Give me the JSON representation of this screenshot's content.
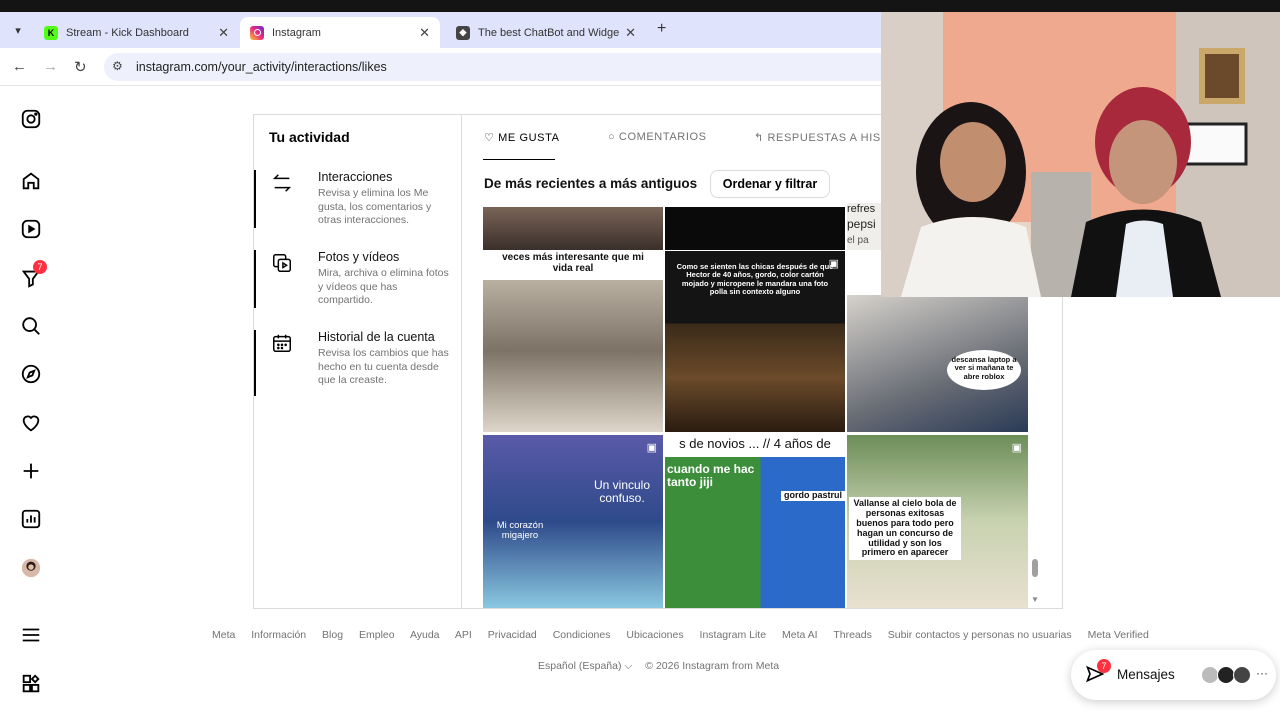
{
  "browser": {
    "tabs": [
      {
        "title": "Stream - Kick Dashboard",
        "favicon": "kick-logo",
        "active": false
      },
      {
        "title": "Instagram",
        "favicon": "instagram-logo",
        "active": true
      },
      {
        "title": "The best ChatBot and Widgets f",
        "favicon": "botrix-logo",
        "active": false
      }
    ],
    "url": "instagram.com/your_activity/interactions/likes"
  },
  "rail": {
    "notifications_badge": "7"
  },
  "activity": {
    "title": "Tu actividad",
    "items": [
      {
        "heading": "Interacciones",
        "desc": "Revisa y elimina los Me gusta, los comentarios y otras interacciones."
      },
      {
        "heading": "Fotos y vídeos",
        "desc": "Mira, archiva o elimina fotos y vídeos que has compartido."
      },
      {
        "heading": "Historial de la cuenta",
        "desc": "Revisa los cambios que has hecho en tu cuenta desde que la creaste."
      }
    ],
    "tabs": [
      {
        "label": "ME GUSTA"
      },
      {
        "label": "COMENTARIOS"
      },
      {
        "label": "RESPUESTAS A HISTO"
      }
    ],
    "sort_label": "De más recientes a más antiguos",
    "sort_button": "Ordenar y filtrar",
    "memes": {
      "c1": "veces más interesante que mi vida real",
      "c2": "Como se sienten las chicas después de que Hector de 40 años, gordo, color cartón mojado y micropene le mandara una foto polla sin contexto alguno",
      "c3a": "refres",
      "c3b": "pepsi",
      "c3c": "el pa",
      "c4": "descansa laptop a ver si mañana te abre roblox",
      "c5a": "Un vinculo confuso.",
      "c5b": "Mi corazón migajero",
      "c6a": "s de novios ... // 4 años de",
      "c6b": "cuando me hac tanto jiji",
      "c6c": "gordo pastrul",
      "c7": "Vallanse al cielo bola de personas exitosas buenos para todo pero hagan un concurso de utilidad y son los primero en aparecer"
    }
  },
  "footer": {
    "links": [
      "Meta",
      "Información",
      "Blog",
      "Empleo",
      "Ayuda",
      "API",
      "Privacidad",
      "Condiciones",
      "Ubicaciones",
      "Instagram Lite",
      "Meta AI",
      "Threads",
      "Subir contactos y personas no usuarias",
      "Meta Verified"
    ],
    "language": "Español (España)",
    "copyright": "© 2026 Instagram from Meta"
  },
  "messages": {
    "label": "Mensajes",
    "badge": "7"
  }
}
